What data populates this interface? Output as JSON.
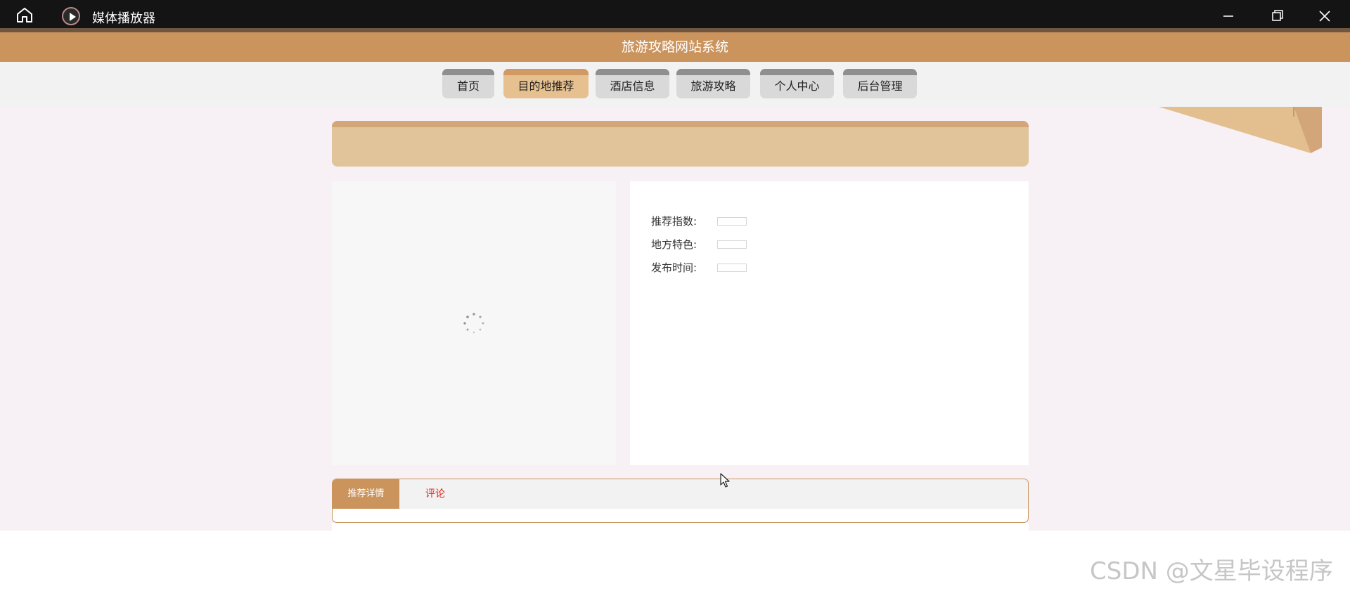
{
  "window": {
    "title": "媒体播放器"
  },
  "app": {
    "site_title": "旅游攻略网站系统"
  },
  "nav": {
    "items": [
      {
        "label": "首页",
        "active": false
      },
      {
        "label": "目的地推荐",
        "active": true
      },
      {
        "label": "酒店信息",
        "active": false
      },
      {
        "label": "旅游攻略",
        "active": false
      },
      {
        "label": "个人中心",
        "active": false
      },
      {
        "label": "后台管理",
        "active": false
      }
    ]
  },
  "detail": {
    "fields": [
      {
        "label": "推荐指数:",
        "value": ""
      },
      {
        "label": "地方特色:",
        "value": ""
      },
      {
        "label": "发布时间:",
        "value": ""
      }
    ]
  },
  "tabs": {
    "detail_label": "推荐详情",
    "comment_label": "评论"
  },
  "watermark": "CSDN @文星毕设程序",
  "colors": {
    "brand": "#cb945d",
    "nav_active": "#e7c08f",
    "banner": "#e1c49a",
    "page_bg": "#f7f0f4",
    "comment_tab_text": "#e0271f"
  },
  "icons": {
    "home": "home-icon",
    "app": "media-player-icon",
    "minimize": "minimize-icon",
    "maximize": "restore-icon",
    "close": "close-icon",
    "loading": "loading-spinner-icon",
    "cursor": "mouse-cursor-icon"
  }
}
